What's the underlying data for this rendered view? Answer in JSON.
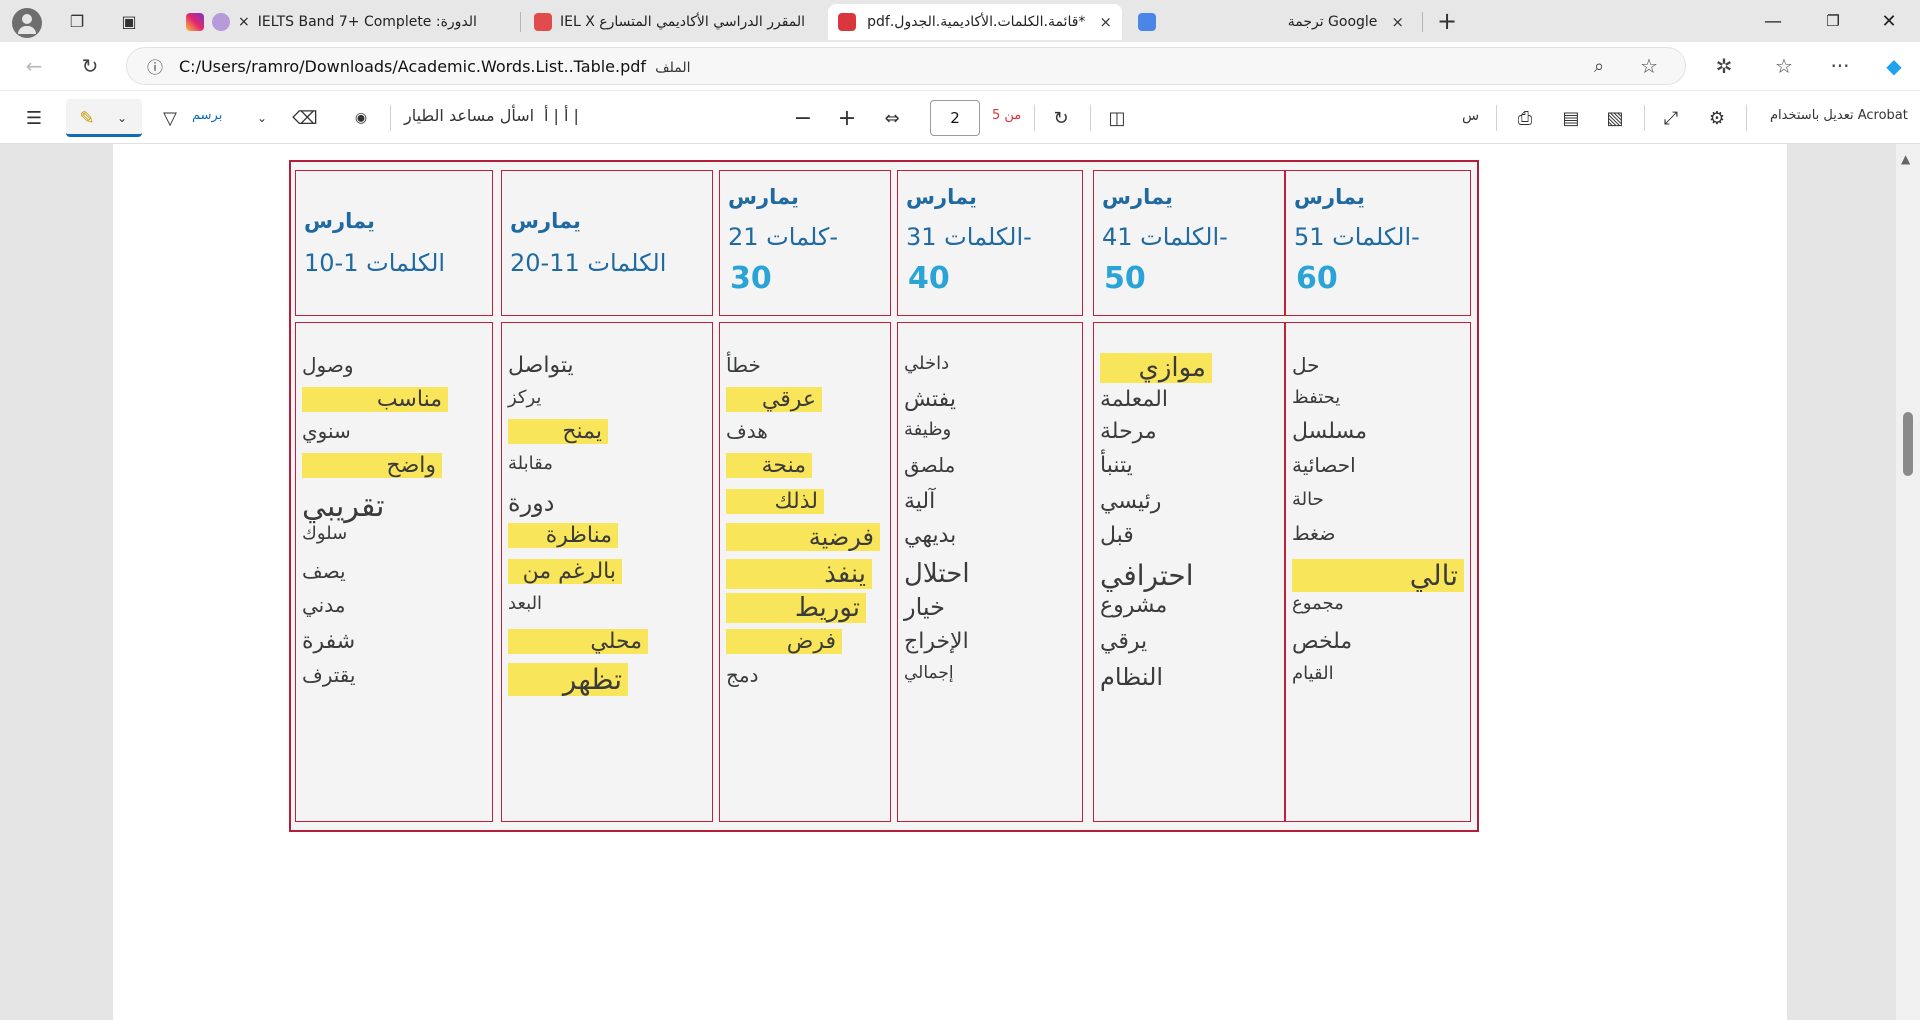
{
  "browser": {
    "tabs": [
      {
        "label": "الدورة: IELTS Band 7+ Complete",
        "icon": "course-icon",
        "active": false
      },
      {
        "label": "المقرر الدراسي الأكاديمي المتسارع IEL X",
        "icon": "pdf-icon",
        "active": false
      },
      {
        "label": "*قائمة.الكلمات.الأكاديمية.الجدول.pdf",
        "icon": "pdf-icon",
        "active": true
      },
      {
        "label": "ترجمة Google",
        "icon": "translate-icon",
        "active": false
      }
    ],
    "url": "C:/Users/ramro/Downloads/Academic.Words.List..Table.pdf",
    "url_label": "الملف",
    "tab_close": "×",
    "new_tab": "+"
  },
  "pdf_toolbar": {
    "draw_label": "برسم",
    "ask_copilot": "اسأل مساعد الطيار",
    "text_size": "أ | أ |",
    "page_current": "2",
    "page_of": "من 5",
    "read_aloud": "س",
    "edit_acrobat": "تعديل باستخدام Acrobat"
  },
  "document": {
    "headers": [
      {
        "l1": "يمارس",
        "l2": "الكلمات 51-",
        "l3": "60"
      },
      {
        "l1": "يمارس",
        "l2": "الكلمات 41-",
        "l3": "50"
      },
      {
        "l1": "يمارس",
        "l2": "الكلمات 31-",
        "l3": "40"
      },
      {
        "l1": "يمارس",
        "l2": "كلمات 21-",
        "l3": "30"
      },
      {
        "l1": "يمارس",
        "l2": "الكلمات 11-20",
        "l3": ""
      },
      {
        "l1": "يمارس",
        "l2": "الكلمات 1-10",
        "l3": ""
      }
    ],
    "columns": [
      [
        "حل",
        "يحتفظ",
        "مسلسل",
        "احصائية",
        "حالة",
        "ضغط",
        "تالي",
        "مجموع",
        "ملخص",
        "القيام"
      ],
      [
        "موازي",
        "المعلمة",
        "مرحلة",
        "يتنبأ",
        "رئيسي",
        "قبل",
        "احترافي",
        "مشروع",
        "يرقي",
        "النظام"
      ],
      [
        "داخلي",
        "يفتش",
        "وظيفة",
        "ملصق",
        "آلية",
        "بديهي",
        "احتلال",
        "خيار",
        "الإخراج",
        "إجمالي"
      ],
      [
        "خطأ",
        "عرقي",
        "هدف",
        "منحة",
        "لذلك",
        "فرضية",
        "ينفذ",
        "توريط",
        "فرض",
        "دمج"
      ],
      [
        "يتواصل",
        "يركز",
        "يمنح",
        "مقابلة",
        "دورة",
        "مناظرة",
        "بالرغم من",
        "البعد",
        "محلي",
        "تظهر"
      ],
      [
        "وصول",
        "مناسب",
        "سنوي",
        "واضح",
        "تقريبي",
        "سلوك",
        "يصف",
        "مدني",
        "شفرة",
        "يقترف"
      ]
    ]
  },
  "colors": {
    "highlight": "#f9e55a",
    "table_border": "#c2203c",
    "header_text": "#1f6aa0",
    "header_number": "#2aa4d6"
  }
}
